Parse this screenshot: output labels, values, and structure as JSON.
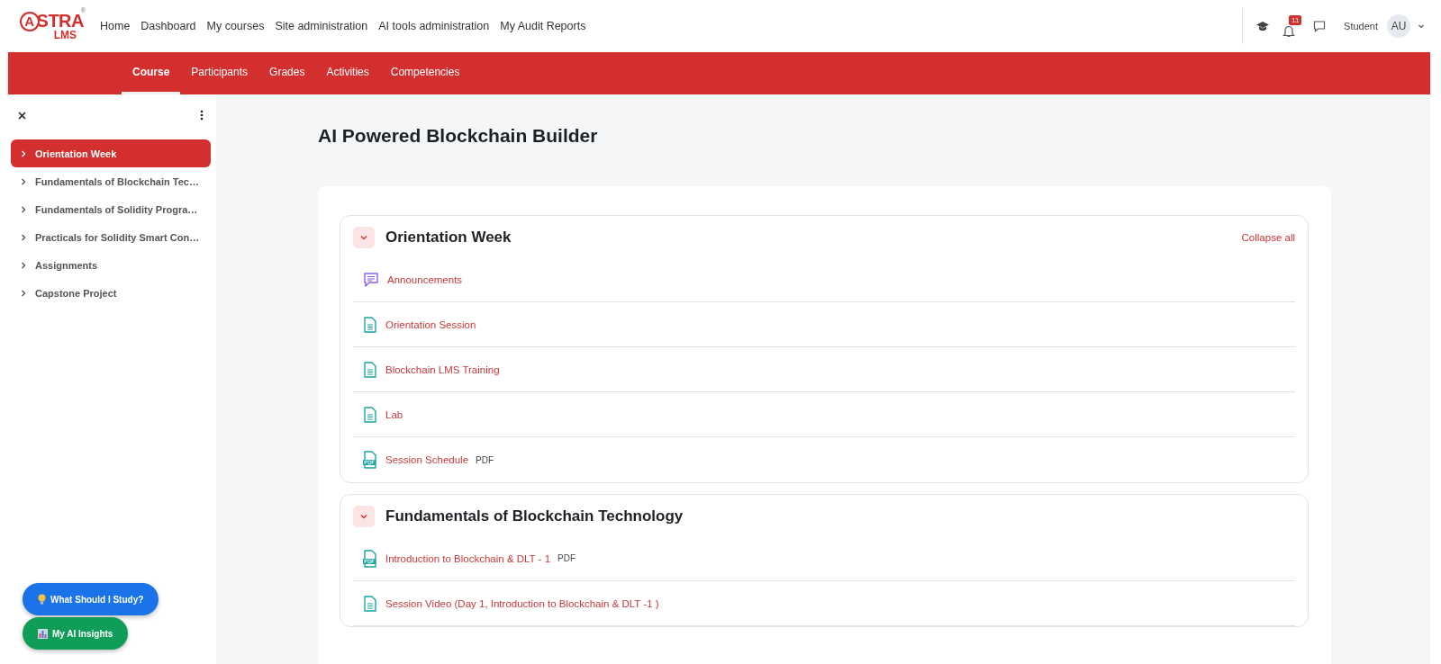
{
  "logo": {
    "word": "STRA",
    "accent": "A",
    "sub": "LMS",
    "mark": "®"
  },
  "top_nav": [
    "Home",
    "Dashboard",
    "My courses",
    "Site administration",
    "AI tools administration",
    "My Audit Reports"
  ],
  "user_menu": {
    "notification_count": "11",
    "role": "Student",
    "initials": "AU"
  },
  "course_tabs": [
    {
      "label": "Course",
      "selected": true
    },
    {
      "label": "Participants",
      "selected": false
    },
    {
      "label": "Grades",
      "selected": false
    },
    {
      "label": "Activities",
      "selected": false
    },
    {
      "label": "Competencies",
      "selected": false
    }
  ],
  "sidebar": {
    "items": [
      {
        "label": "Orientation Week",
        "selected": true
      },
      {
        "label": "Fundamentals of Blockchain Tec…",
        "selected": false
      },
      {
        "label": "Fundamentals of Solidity Progra…",
        "selected": false
      },
      {
        "label": "Practicals for Solidity Smart Con…",
        "selected": false
      },
      {
        "label": "Assignments",
        "selected": false
      },
      {
        "label": "Capstone Project",
        "selected": false
      }
    ]
  },
  "floating_buttons": [
    {
      "label": "What Should I Study?",
      "kind": "bulb",
      "color": "#1a73e8"
    },
    {
      "label": "My AI Insights",
      "kind": "chart",
      "color": "#0f9d58"
    }
  ],
  "course_title": "AI Powered Blockchain Builder",
  "collapse_all": "Collapse all",
  "sections": [
    {
      "title": "Orientation Week",
      "expanded": true,
      "activities": [
        {
          "kind": "forum",
          "name": "Announcements"
        },
        {
          "kind": "page",
          "name": "Orientation Session"
        },
        {
          "kind": "page",
          "name": "Blockchain LMS Training"
        },
        {
          "kind": "page",
          "name": "Lab"
        },
        {
          "kind": "pdf",
          "name": "Session Schedule",
          "tag": "PDF"
        }
      ]
    },
    {
      "title": "Fundamentals of Blockchain Technology",
      "expanded": true,
      "activities": [
        {
          "kind": "pdf",
          "name": "Introduction to Blockchain & DLT - 1",
          "tag": "PDF"
        },
        {
          "kind": "page",
          "name": "Session Video (Day 1, Introduction to Blockchain & DLT -1 )"
        }
      ]
    }
  ]
}
